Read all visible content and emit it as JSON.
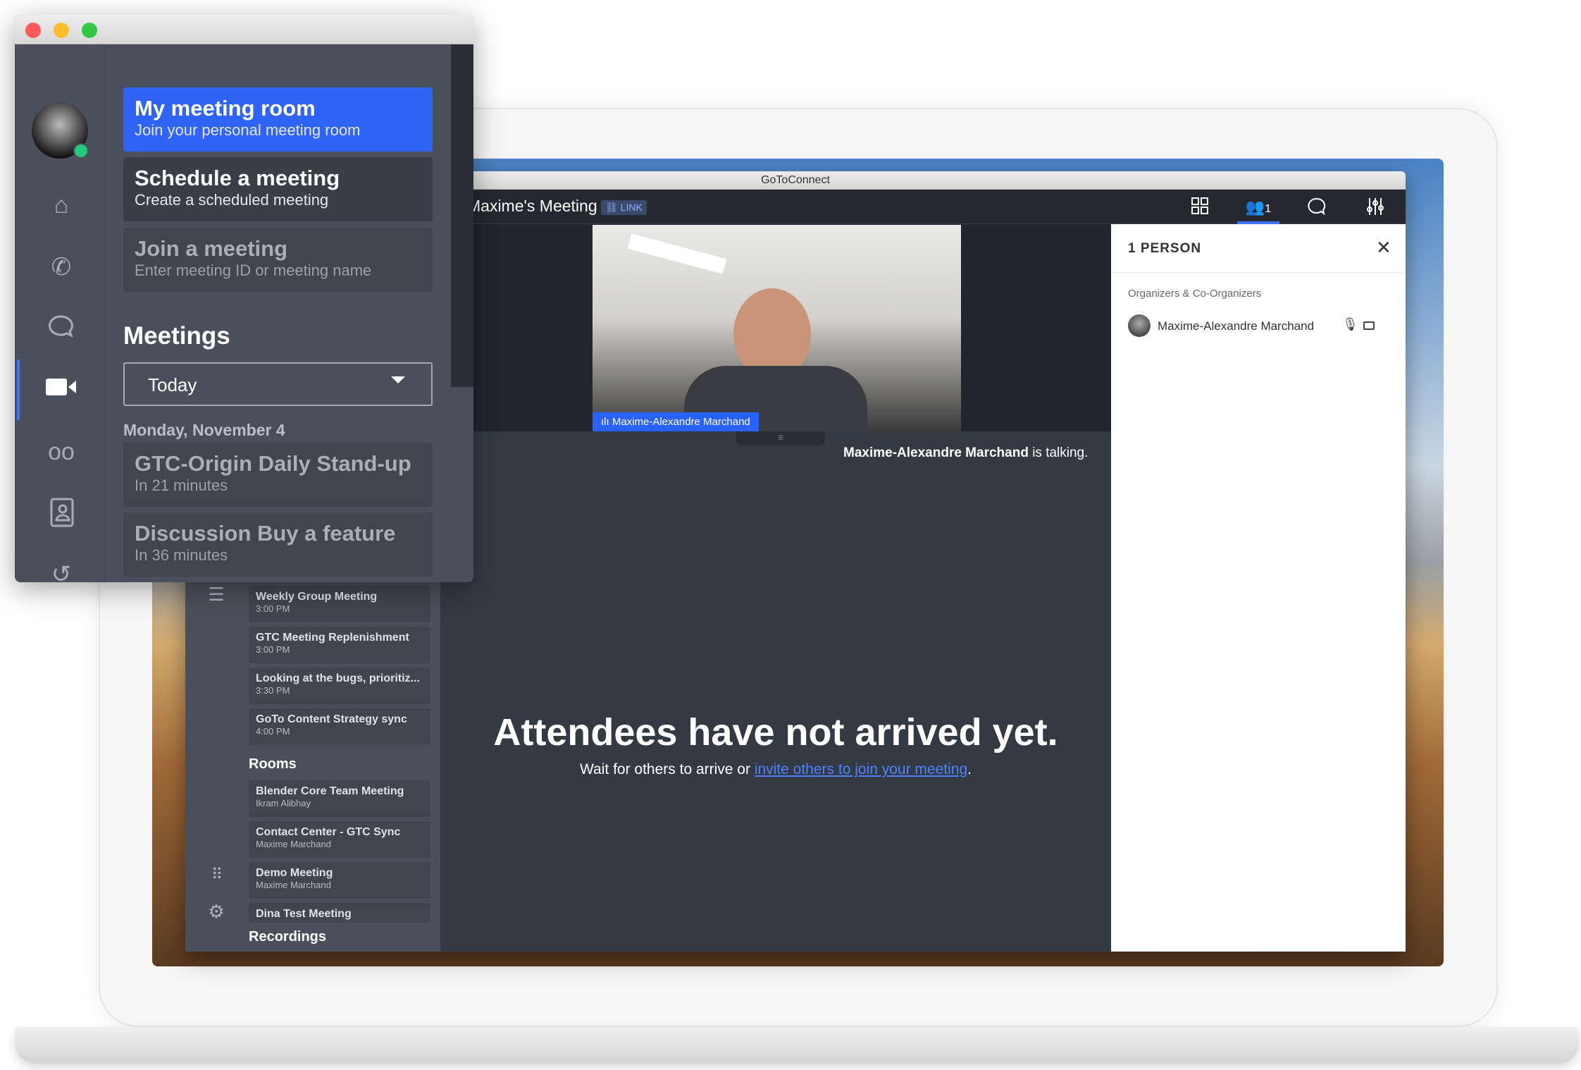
{
  "window_title": "GoToConnect",
  "meeting": {
    "title": "Maxime's Meeting",
    "link_badge": "LINK",
    "header_icons": [
      "grid-icon",
      "people-icon",
      "chat-icon",
      "settings-sliders-icon"
    ],
    "people_count": "1"
  },
  "video": {
    "participant": "Maxime-Alexandre Marchand"
  },
  "talking": {
    "name": "Maxime-Alexandre Marchand",
    "suffix": " is talking."
  },
  "empty_state": {
    "title": "Attendees have not arrived yet.",
    "prefix": "Wait for others to arrive or ",
    "link": "invite others to join your meeting",
    "suffix": "."
  },
  "people_panel": {
    "title": "1 PERSON",
    "section": "Organizers & Co-Organizers",
    "participants": [
      {
        "name": "Maxime-Alexandre Marchand"
      }
    ]
  },
  "big_sidebar": {
    "meetings": [
      {
        "title": "Weekly Group Meeting",
        "sub": "3:00 PM"
      },
      {
        "title": "GTC Meeting Replenishment",
        "sub": "3:00 PM"
      },
      {
        "title": "Looking at the bugs, prioritiz...",
        "sub": "3:30 PM"
      },
      {
        "title": "GoTo Content Strategy sync",
        "sub": "4:00 PM"
      }
    ],
    "rooms_header": "Rooms",
    "rooms": [
      {
        "title": "Blender Core Team Meeting",
        "sub": "Ikram Alibhay"
      },
      {
        "title": "Contact Center - GTC Sync",
        "sub": "Maxime Marchand"
      },
      {
        "title": "Demo Meeting",
        "sub": "Maxime Marchand"
      },
      {
        "title": "Dina Test Meeting",
        "sub": ""
      }
    ],
    "recordings_header": "Recordings"
  },
  "small_window": {
    "nav_icons": [
      "home-icon",
      "phone-icon",
      "chat-icon",
      "video-icon",
      "voicemail-icon",
      "contacts-icon",
      "history-icon"
    ],
    "active_nav": "video-icon",
    "cards": [
      {
        "title": "My meeting room",
        "sub": "Join your personal meeting room"
      },
      {
        "title": "Schedule a meeting",
        "sub": "Create a scheduled meeting"
      },
      {
        "title": "Join a meeting",
        "sub": "Enter meeting ID or meeting name"
      }
    ],
    "meetings_header": "Meetings",
    "filter": "Today",
    "date": "Monday, November 4",
    "upcoming": [
      {
        "title": "GTC-Origin Daily Stand-up",
        "sub": "In 21 minutes"
      },
      {
        "title": "Discussion Buy a feature",
        "sub": "In 36 minutes"
      }
    ]
  },
  "colors": {
    "accent": "#2962ff",
    "status_online": "#22c97a",
    "panel_bg": "#4a505b"
  }
}
